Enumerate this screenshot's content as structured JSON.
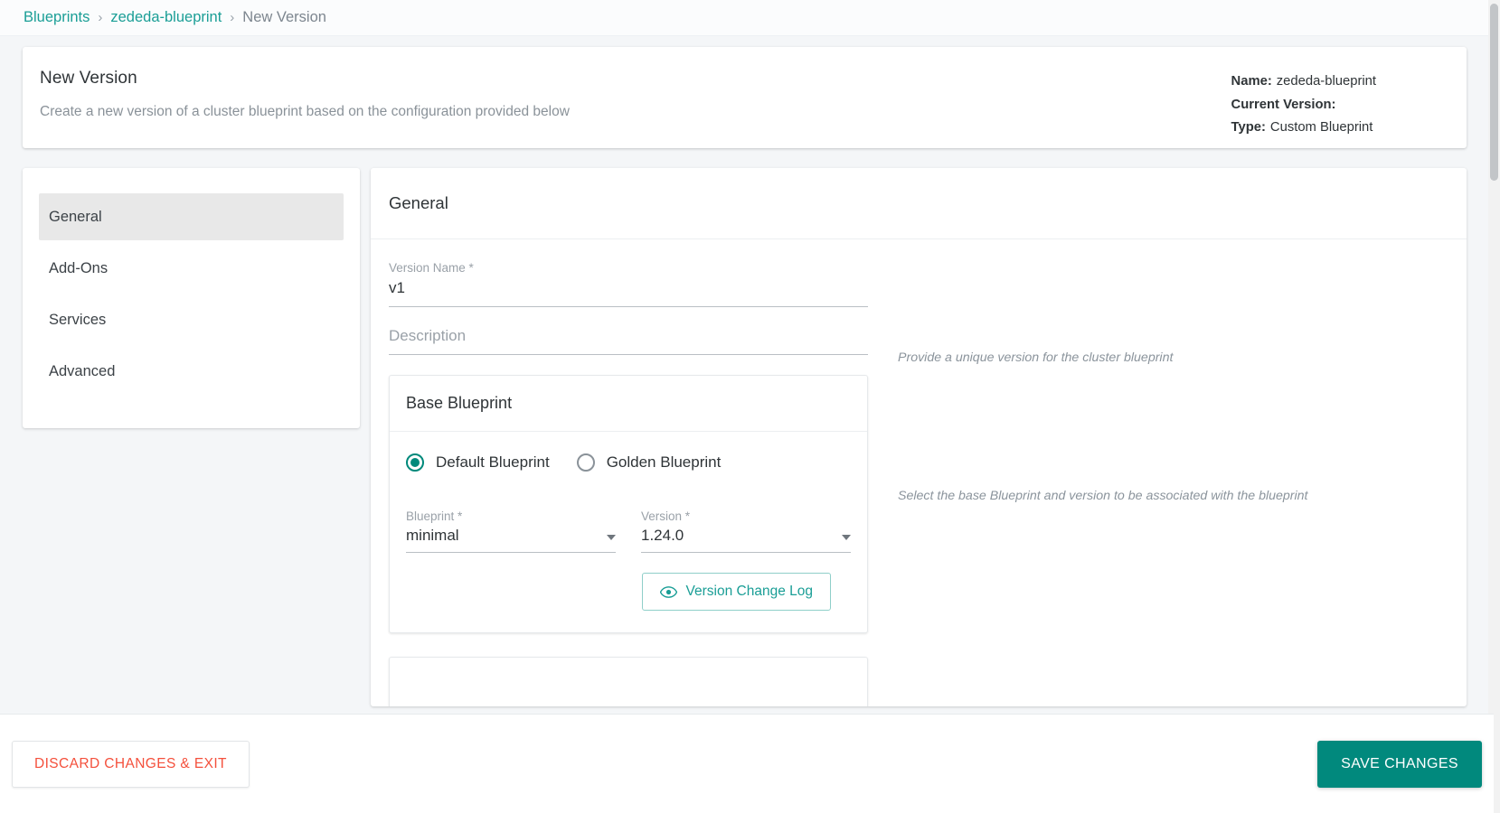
{
  "breadcrumb": {
    "items": [
      {
        "label": "Blueprints",
        "type": "link"
      },
      {
        "label": "zededa-blueprint",
        "type": "link"
      },
      {
        "label": "New Version",
        "type": "current"
      }
    ],
    "separator": "›"
  },
  "header": {
    "title": "New Version",
    "subtitle": "Create a new version of a cluster blueprint based on the configuration provided below",
    "meta": [
      {
        "key": "Name:",
        "value": "zededa-blueprint"
      },
      {
        "key": "Current Version:",
        "value": ""
      },
      {
        "key": "Type:",
        "value": "Custom Blueprint"
      }
    ]
  },
  "sidebar": {
    "items": [
      {
        "label": "General",
        "active": true
      },
      {
        "label": "Add-Ons",
        "active": false
      },
      {
        "label": "Services",
        "active": false
      },
      {
        "label": "Advanced",
        "active": false
      }
    ]
  },
  "main": {
    "section_title": "General",
    "version_name": {
      "label": "Version Name *",
      "value": "v1",
      "hint": "Provide a unique version for the cluster blueprint"
    },
    "description": {
      "label": "",
      "placeholder": "Description",
      "value": ""
    },
    "base_blueprint": {
      "title": "Base Blueprint",
      "hint": "Select the base Blueprint and version to be associated with the blueprint",
      "radios": [
        {
          "label": "Default Blueprint",
          "checked": true
        },
        {
          "label": "Golden Blueprint",
          "checked": false
        }
      ],
      "blueprint_select": {
        "label": "Blueprint *",
        "value": "minimal"
      },
      "version_select": {
        "label": "Version *",
        "value": "1.24.0"
      },
      "changelog_button": "Version Change Log"
    }
  },
  "footer": {
    "discard_label": "DISCARD CHANGES & EXIT",
    "save_label": "SAVE CHANGES"
  },
  "colors": {
    "accent": "#00897b",
    "link": "#1a9e96",
    "danger": "#f4503c",
    "page_bg": "#f4f6f8"
  }
}
